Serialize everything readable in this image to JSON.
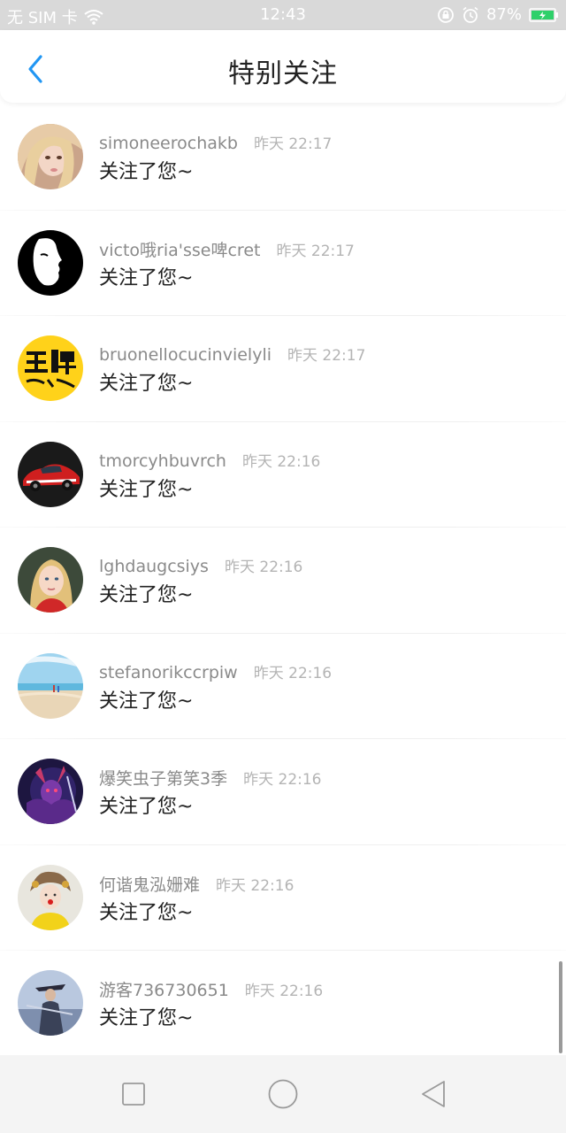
{
  "status_bar": {
    "carrier": "无 SIM 卡",
    "time": "12:43",
    "battery": "87%",
    "icons": [
      "wifi-icon",
      "lock-rotation-icon",
      "alarm-icon",
      "battery-icon"
    ]
  },
  "header": {
    "title": "特别关注",
    "back_icon": "chevron-left-icon"
  },
  "colors": {
    "accent": "#2196f3",
    "status_bar_bg": "#d9d9d9",
    "battery_fill": "#2fd06a",
    "username": "#8a8a8a",
    "timestamp": "#b4b4b4"
  },
  "items": [
    {
      "username": "simoneerochakb",
      "time": "昨天 22:17",
      "message": "关注了您~",
      "avatar": "blonde-girl-avatar"
    },
    {
      "username": "victo哦ria'sse啤cret",
      "time": "昨天 22:17",
      "message": "关注了您~",
      "avatar": "face-silhouette-avatar"
    },
    {
      "username": "bruonellocucinvielyli",
      "time": "昨天 22:17",
      "message": "关注了您~",
      "avatar": "wangpai-logo-avatar"
    },
    {
      "username": "tmorcyhbuvrch",
      "time": "昨天 22:16",
      "message": "关注了您~",
      "avatar": "rally-car-avatar"
    },
    {
      "username": "lghdaugcsiys",
      "time": "昨天 22:16",
      "message": "关注了您~",
      "avatar": "child-portrait-avatar"
    },
    {
      "username": "stefanorikccrpiw",
      "time": "昨天 22:16",
      "message": "关注了您~",
      "avatar": "beach-avatar"
    },
    {
      "username": "爆笑虫子第笑3季",
      "time": "昨天 22:16",
      "message": "关注了您~",
      "avatar": "game-character-avatar"
    },
    {
      "username": "何谐鬼泓姗难",
      "time": "昨天 22:16",
      "message": "关注了您~",
      "avatar": "costume-girl-avatar"
    },
    {
      "username": "游客736730651",
      "time": "昨天 22:16",
      "message": "关注了您~",
      "avatar": "warrior-avatar"
    }
  ],
  "nav_bar": {
    "buttons": [
      "recent-apps-icon",
      "home-icon",
      "back-triangle-icon"
    ]
  }
}
